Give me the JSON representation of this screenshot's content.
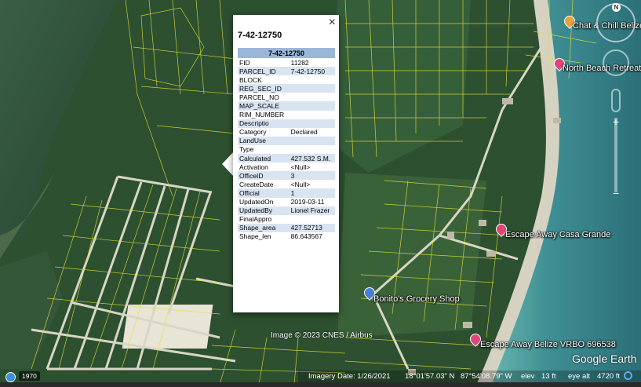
{
  "popup": {
    "title": "7-42-12750",
    "close_label": "×",
    "table_header": "7-42-12750",
    "rows": [
      {
        "key": "FID",
        "value": "11282"
      },
      {
        "key": "PARCEL_ID",
        "value": "7-42-12750"
      },
      {
        "key": "BLOCK",
        "value": ""
      },
      {
        "key": "REG_SEC_ID",
        "value": ""
      },
      {
        "key": "PARCEL_NO",
        "value": ""
      },
      {
        "key": "MAP_SCALE",
        "value": ""
      },
      {
        "key": "RIM_NUMBER",
        "value": ""
      },
      {
        "key": "Descriptio",
        "value": ""
      },
      {
        "key": "Category",
        "value": "Declared"
      },
      {
        "key": "LandUse",
        "value": ""
      },
      {
        "key": "Type",
        "value": ""
      },
      {
        "key": "Calculated",
        "value": "427.532 S.M."
      },
      {
        "key": "Activation",
        "value": "<Null>"
      },
      {
        "key": "OfficeID",
        "value": "3"
      },
      {
        "key": "CreateDate",
        "value": "<Null>"
      },
      {
        "key": "Official",
        "value": "1"
      },
      {
        "key": "UpdatedOn",
        "value": "2019-03-11"
      },
      {
        "key": "UpdatedBy",
        "value": "Lionel Frazer"
      },
      {
        "key": "FinalAppro",
        "value": ""
      },
      {
        "key": "Shape_area",
        "value": "427.52713"
      },
      {
        "key": "Shape_len",
        "value": "86.643567"
      }
    ]
  },
  "places": [
    {
      "name": "Chat & Chill Belize",
      "color": "#e8a23a"
    },
    {
      "name": "North Beach Retreat",
      "color": "#e0457a"
    },
    {
      "name": "Escape Away Casa Grande",
      "color": "#e0457a"
    },
    {
      "name": "Bonito's Grocery Shop",
      "color": "#4a7fd8"
    },
    {
      "name": "Escape Away Belize VRBO 696538",
      "color": "#e0457a"
    }
  ],
  "compass_label": "N",
  "attribution": "Image © 2023 CNES / Airbus",
  "logo": "Google Earth",
  "status": {
    "year": "1970",
    "imagery_date": "Imagery Date: 1/26/2021",
    "lat": "18°01'57.03\" N",
    "lon": "87°54'08.79\" W",
    "elev_label": "elev",
    "elev_value": "13 ft",
    "eye_label": "eye alt",
    "eye_value": "4720 ft"
  },
  "colors": {
    "parcel_lines": "#e6e23a",
    "roads": "#d8d6c6",
    "sea": "#3f8f94",
    "vegetation": "#2f5a34"
  }
}
